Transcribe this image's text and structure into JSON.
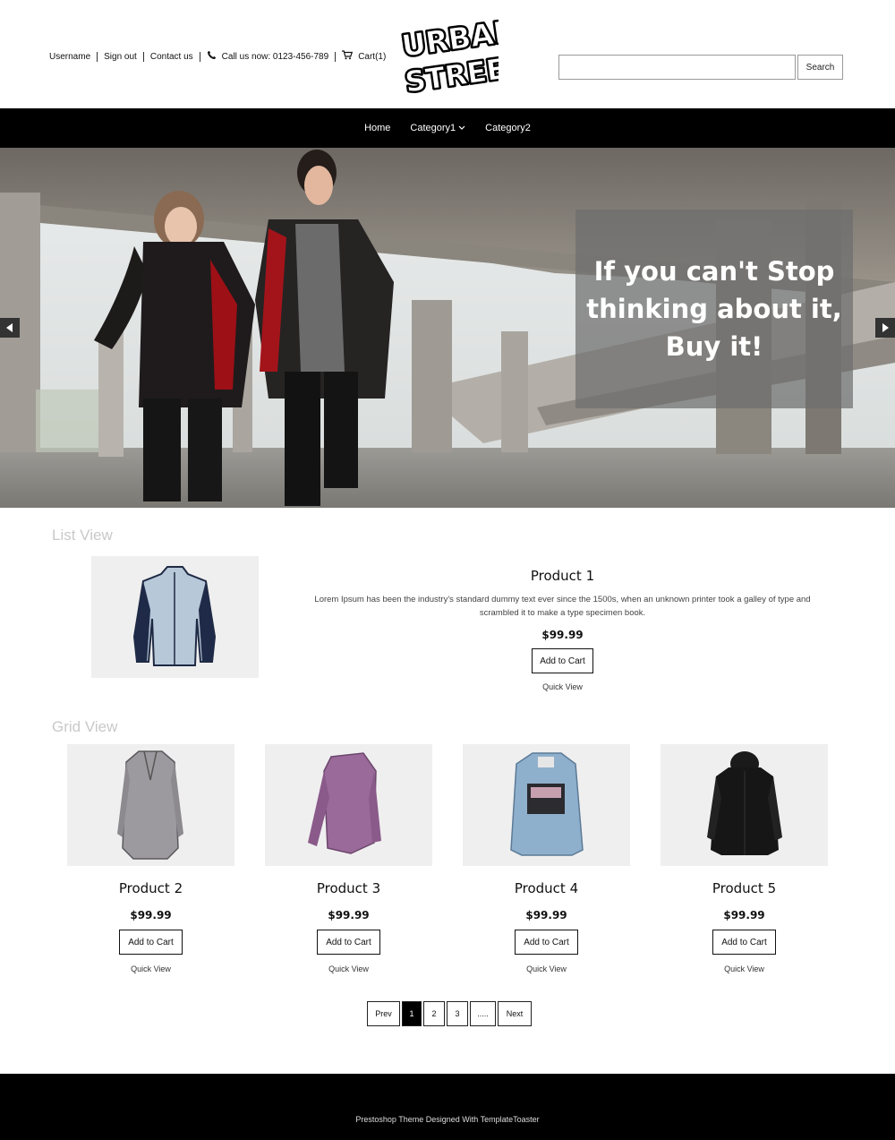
{
  "header": {
    "links": {
      "username": "Username",
      "sign_out": "Sign out",
      "contact": "Contact us",
      "phone": "Call us now: 0123-456-789",
      "cart": "Cart(1)"
    },
    "logo_line1": "URBAN",
    "logo_line2": "STREET",
    "search": {
      "value": "",
      "placeholder": "",
      "button": "Search"
    }
  },
  "nav": {
    "items": [
      {
        "label": "Home"
      },
      {
        "label": "Category1",
        "icon": "chevron-down-icon"
      },
      {
        "label": "Category2"
      }
    ]
  },
  "hero": {
    "caption": "If you can't Stop thinking about it, Buy it!"
  },
  "list_view": {
    "title": "List View",
    "product": {
      "name": "Product 1",
      "description": "Lorem Ipsum has been the industry's standard dummy text ever since the 1500s, when an unknown printer took a galley of type and scrambled it to make a type specimen book.",
      "price": "$99.99",
      "add_to_cart": "Add to Cart",
      "quick_view": "Quick View"
    }
  },
  "grid_view": {
    "title": "Grid View",
    "products": [
      {
        "name": "Product 2",
        "price": "$99.99",
        "add_to_cart": "Add to Cart",
        "quick_view": "Quick View"
      },
      {
        "name": "Product 3",
        "price": "$99.99",
        "add_to_cart": "Add to Cart",
        "quick_view": "Quick View"
      },
      {
        "name": "Product 4",
        "price": "$99.99",
        "add_to_cart": "Add to Cart",
        "quick_view": "Quick View"
      },
      {
        "name": "Product 5",
        "price": "$99.99",
        "add_to_cart": "Add to Cart",
        "quick_view": "Quick View"
      }
    ]
  },
  "pagination": {
    "prev": "Prev",
    "pages": [
      "1",
      "2",
      "3",
      "....."
    ],
    "active_page": "1",
    "next": "Next"
  },
  "footer": {
    "text": "Prestoshop Theme Designed With TemplateToaster"
  },
  "colors": {
    "nav_bg": "#000000",
    "footer_bg": "#000000",
    "caption_overlay": "#6e6e6e",
    "section_title": "#c9c9c9",
    "image_bg": "#efefef"
  }
}
